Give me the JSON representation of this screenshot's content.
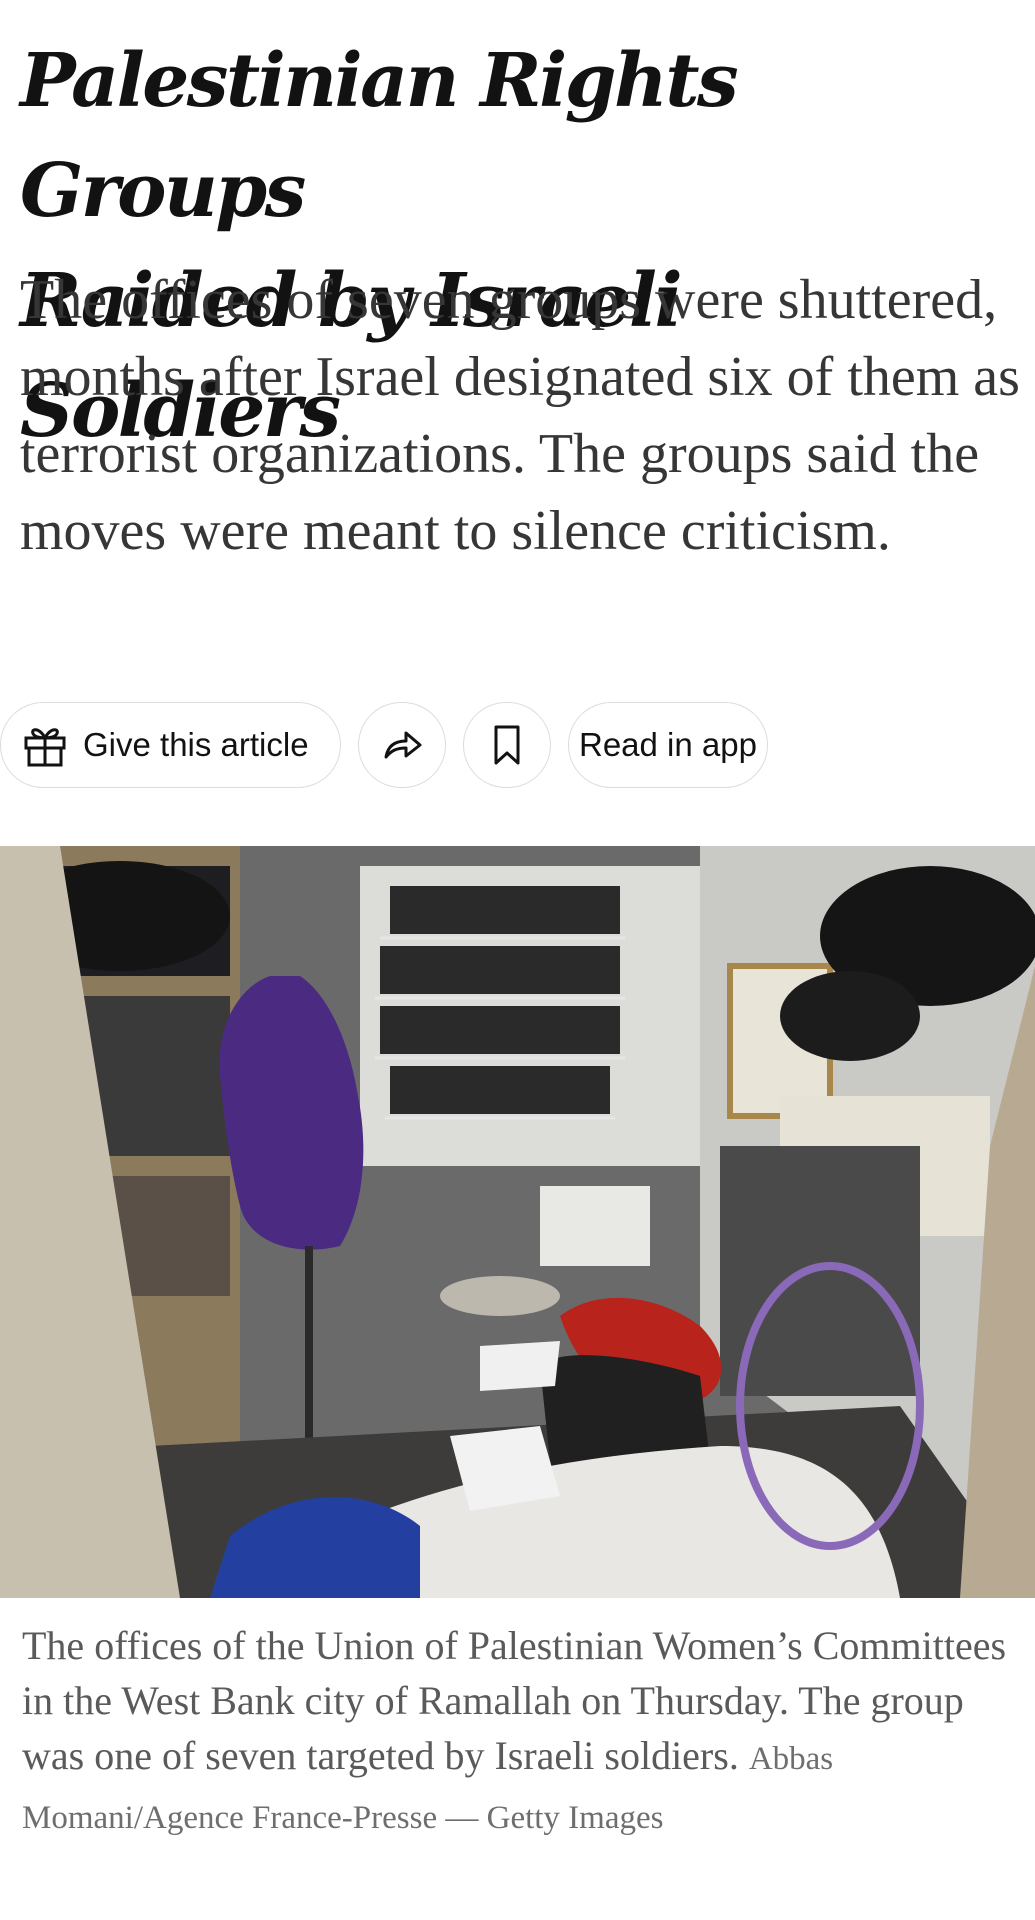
{
  "article": {
    "headline_line1": "Palestinian Rights Groups",
    "headline_line2": "Raided by Israeli Soldiers",
    "summary": "The offices of seven groups were shuttered, months after Israel designated six of them as terrorist organizations. The groups said the moves were meant to silence criticism."
  },
  "share_bar": {
    "gift_label": "Give this article",
    "gift_icon": "gift-icon",
    "share_icon": "share-arrow-icon",
    "save_icon": "bookmark-icon",
    "app_label": "Read in app"
  },
  "photo": {
    "caption": "The offices of the Union of Palestinian Women’s Committees in the West Bank city of Ramallah on Thursday. The group was one of seven targeted by Israeli soldiers.",
    "credit": "Abbas Momani/Agence France-Presse — Getty Images"
  },
  "colors": {
    "headline": "#121212",
    "summary": "#363636",
    "caption": "#5a5a5a",
    "pill_border": "#dcdcdc"
  }
}
